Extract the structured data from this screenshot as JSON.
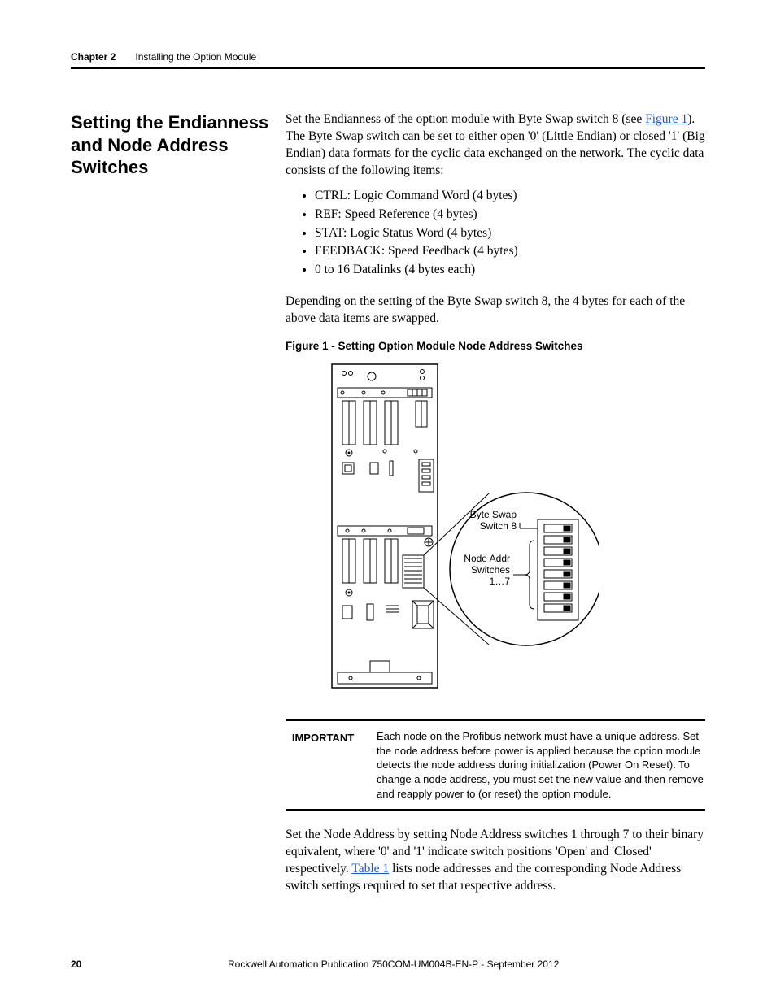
{
  "header": {
    "chapter": "Chapter 2",
    "title": "Installing the Option Module"
  },
  "section": {
    "heading": "Setting the Endianness and Node Address Switches",
    "para1_pre": "Set the Endianness of the option module with Byte Swap switch 8 (see ",
    "para1_link": "Figure 1",
    "para1_post": "). The Byte Swap switch can be set to either open '0' (Little Endian) or closed '1' (Big Endian) data formats for the cyclic data exchanged on the network. The cyclic data consists of the following items:",
    "bullets": [
      "CTRL: Logic Command Word (4 bytes)",
      "REF: Speed Reference (4 bytes)",
      "STAT: Logic Status Word (4 bytes)",
      "FEEDBACK: Speed Feedback (4 bytes)",
      "0 to 16 Datalinks (4 bytes each)"
    ],
    "para2": "Depending on the setting of the Byte Swap switch 8, the 4 bytes for each of the above data items are swapped."
  },
  "figure": {
    "caption": "Figure 1 - Setting Option Module Node Address Switches",
    "callouts": {
      "byte_swap_l1": "Byte Swap",
      "byte_swap_l2": "Switch 8",
      "node_addr_l1": "Node Addr",
      "node_addr_l2": "Switches",
      "node_addr_l3": "1…7"
    }
  },
  "important": {
    "label": "IMPORTANT",
    "text": "Each node on the Profibus network must have a unique address. Set the node address before power is applied because the option module detects the node address during initialization (Power On Reset). To change a node address, you must set the new value and then remove and reapply power to (or reset) the option module."
  },
  "closing": {
    "pre": "Set the Node Address by setting Node Address switches 1 through 7 to their binary equivalent, where '0' and '1' indicate switch positions 'Open' and 'Closed' respectively. ",
    "link": "Table 1",
    "post": " lists node addresses and the corresponding Node Address switch settings required to set that respective address."
  },
  "footer": {
    "page": "20",
    "pub": "Rockwell Automation Publication 750COM-UM004B-EN-P - September 2012"
  }
}
